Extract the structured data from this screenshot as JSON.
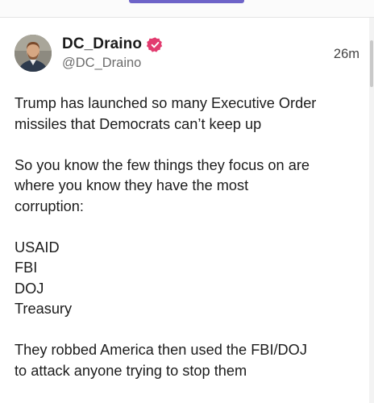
{
  "post": {
    "author": {
      "display_name": "DC_Draino",
      "handle": "@DC_Draino",
      "verified_icon": "verified-badge-icon",
      "verified_color": "#e23b6f"
    },
    "timestamp": "26m",
    "body": {
      "p1_line1": "Trump has launched so many Executive Order",
      "p1_line2": "missiles that Democrats can’t keep up",
      "p2_line1": "So you know the few things they focus on are",
      "p2_line2": "where you know they have the most",
      "p2_line3": "corruption:",
      "list": [
        "USAID",
        "FBI",
        "DOJ",
        "Treasury"
      ],
      "p3_line1": "They robbed America then used the FBI/DOJ",
      "p3_line2": "to attack anyone trying to stop them"
    }
  },
  "colors": {
    "tab_indicator": "#6e64c8",
    "text": "#1c1c1c",
    "muted": "#6d6d6d"
  }
}
